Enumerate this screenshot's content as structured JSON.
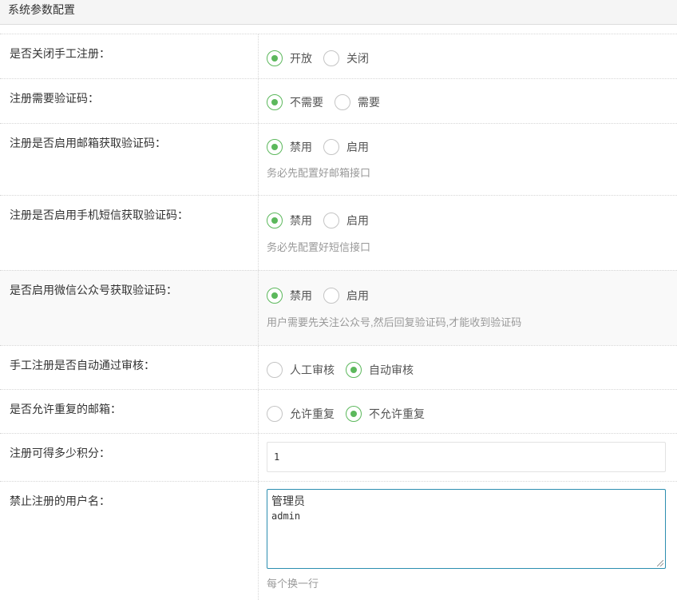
{
  "panel": {
    "title": "系统参数配置"
  },
  "rows": [
    {
      "label": "是否关闭手工注册：",
      "options": [
        "开放",
        "关闭"
      ],
      "selected": 0
    },
    {
      "label": "注册需要验证码：",
      "options": [
        "不需要",
        "需要"
      ],
      "selected": 0
    },
    {
      "label": "注册是否启用邮箱获取验证码：",
      "options": [
        "禁用",
        "启用"
      ],
      "selected": 0,
      "hint": "务必先配置好邮箱接口"
    },
    {
      "label": "注册是否启用手机短信获取验证码：",
      "options": [
        "禁用",
        "启用"
      ],
      "selected": 0,
      "hint": "务必先配置好短信接口"
    },
    {
      "label": "是否启用微信公众号获取验证码：",
      "options": [
        "禁用",
        "启用"
      ],
      "selected": 0,
      "hint": "用户需要先关注公众号,然后回复验证码,才能收到验证码"
    },
    {
      "label": "手工注册是否自动通过审核：",
      "options": [
        "人工审核",
        "自动审核"
      ],
      "selected": 1
    },
    {
      "label": "是否允许重复的邮箱：",
      "options": [
        "允许重复",
        "不允许重复"
      ],
      "selected": 1
    },
    {
      "label": "注册可得多少积分：",
      "value": "1"
    },
    {
      "label": "禁止注册的用户名：",
      "lines": [
        "管理员",
        "admin"
      ],
      "hint": "每个换一行"
    }
  ],
  "colors": {
    "accent": "#5cb85c",
    "focus_border": "#2c8eb0",
    "hint": "#999999"
  }
}
